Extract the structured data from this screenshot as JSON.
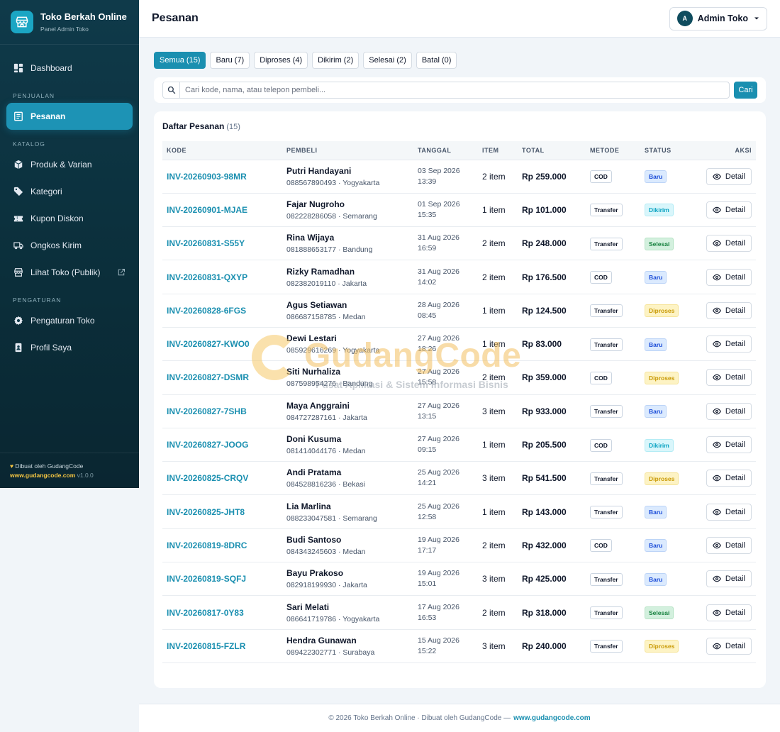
{
  "brand": {
    "name": "Toko Berkah Online",
    "subtitle": "Panel Admin Toko"
  },
  "sidebar": {
    "dashboard": "Dashboard",
    "section_penjualan": "PENJUALAN",
    "pesanan": "Pesanan",
    "section_katalog": "KATALOG",
    "produk": "Produk & Varian",
    "kategori": "Kategori",
    "kupon": "Kupon Diskon",
    "ongkos": "Ongkos Kirim",
    "lihat_toko": "Lihat Toko (Publik)",
    "section_pengaturan": "PENGATURAN",
    "pengaturan_toko": "Pengaturan Toko",
    "profil": "Profil Saya",
    "footer_credit": "Dibuat oleh GudangCode",
    "footer_url": "www.gudangcode.com",
    "footer_version": "v1.0.0"
  },
  "header": {
    "title": "Pesanan",
    "user_initial": "A",
    "user_name": "Admin Toko"
  },
  "tabs": [
    "Semua (15)",
    "Baru (7)",
    "Diproses (4)",
    "Dikirim (2)",
    "Selesai (2)",
    "Batal (0)"
  ],
  "search": {
    "placeholder": "Cari kode, nama, atau telepon pembeli...",
    "button": "Cari"
  },
  "orders_card": {
    "title": "Daftar Pesanan",
    "count": "(15)"
  },
  "columns": {
    "kode": "KODE",
    "pembeli": "PEMBELI",
    "tanggal": "TANGGAL",
    "item": "ITEM",
    "total": "TOTAL",
    "metode": "METODE",
    "status": "STATUS",
    "aksi": "AKSI"
  },
  "detail_label": "Detail",
  "orders": [
    {
      "code": "INV-20260903-98MR",
      "name": "Putri Handayani",
      "phone_city": "088567890493 · Yogyakarta",
      "date": "03 Sep 2026",
      "time": "13:39",
      "items": "2 item",
      "total": "Rp 259.000",
      "method": "COD",
      "status": "Baru",
      "status_class": "s-baru"
    },
    {
      "code": "INV-20260901-MJAE",
      "name": "Fajar Nugroho",
      "phone_city": "082228286058 · Semarang",
      "date": "01 Sep 2026",
      "time": "15:35",
      "items": "1 item",
      "total": "Rp 101.000",
      "method": "Transfer",
      "status": "Dikirim",
      "status_class": "s-dikirim"
    },
    {
      "code": "INV-20260831-S55Y",
      "name": "Rina Wijaya",
      "phone_city": "081888653177 · Bandung",
      "date": "31 Aug 2026",
      "time": "16:59",
      "items": "2 item",
      "total": "Rp 248.000",
      "method": "Transfer",
      "status": "Selesai",
      "status_class": "s-selesai"
    },
    {
      "code": "INV-20260831-QXYP",
      "name": "Rizky Ramadhan",
      "phone_city": "082382019110 · Jakarta",
      "date": "31 Aug 2026",
      "time": "14:02",
      "items": "2 item",
      "total": "Rp 176.500",
      "method": "COD",
      "status": "Baru",
      "status_class": "s-baru"
    },
    {
      "code": "INV-20260828-6FGS",
      "name": "Agus Setiawan",
      "phone_city": "086687158785 · Medan",
      "date": "28 Aug 2026",
      "time": "08:45",
      "items": "1 item",
      "total": "Rp 124.500",
      "method": "Transfer",
      "status": "Diproses",
      "status_class": "s-diproses"
    },
    {
      "code": "INV-20260827-KWO0",
      "name": "Dewi Lestari",
      "phone_city": "085929616269 · Yogyakarta",
      "date": "27 Aug 2026",
      "time": "18:26",
      "items": "1 item",
      "total": "Rp 83.000",
      "method": "Transfer",
      "status": "Baru",
      "status_class": "s-baru"
    },
    {
      "code": "INV-20260827-DSMR",
      "name": "Siti Nurhaliza",
      "phone_city": "087598954276 · Bandung",
      "date": "27 Aug 2026",
      "time": "15:58",
      "items": "2 item",
      "total": "Rp 359.000",
      "method": "COD",
      "status": "Diproses",
      "status_class": "s-diproses"
    },
    {
      "code": "INV-20260827-7SHB",
      "name": "Maya Anggraini",
      "phone_city": "084727287161 · Jakarta",
      "date": "27 Aug 2026",
      "time": "13:15",
      "items": "3 item",
      "total": "Rp 933.000",
      "method": "Transfer",
      "status": "Baru",
      "status_class": "s-baru"
    },
    {
      "code": "INV-20260827-JOOG",
      "name": "Doni Kusuma",
      "phone_city": "081414044176 · Medan",
      "date": "27 Aug 2026",
      "time": "09:15",
      "items": "1 item",
      "total": "Rp 205.500",
      "method": "COD",
      "status": "Dikirim",
      "status_class": "s-dikirim"
    },
    {
      "code": "INV-20260825-CRQV",
      "name": "Andi Pratama",
      "phone_city": "084528816236 · Bekasi",
      "date": "25 Aug 2026",
      "time": "14:21",
      "items": "3 item",
      "total": "Rp 541.500",
      "method": "Transfer",
      "status": "Diproses",
      "status_class": "s-diproses"
    },
    {
      "code": "INV-20260825-JHT8",
      "name": "Lia Marlina",
      "phone_city": "088233047581 · Semarang",
      "date": "25 Aug 2026",
      "time": "12:58",
      "items": "1 item",
      "total": "Rp 143.000",
      "method": "Transfer",
      "status": "Baru",
      "status_class": "s-baru"
    },
    {
      "code": "INV-20260819-8DRC",
      "name": "Budi Santoso",
      "phone_city": "084343245603 · Medan",
      "date": "19 Aug 2026",
      "time": "17:17",
      "items": "2 item",
      "total": "Rp 432.000",
      "method": "COD",
      "status": "Baru",
      "status_class": "s-baru"
    },
    {
      "code": "INV-20260819-SQFJ",
      "name": "Bayu Prakoso",
      "phone_city": "082918199930 · Jakarta",
      "date": "19 Aug 2026",
      "time": "15:01",
      "items": "3 item",
      "total": "Rp 425.000",
      "method": "Transfer",
      "status": "Baru",
      "status_class": "s-baru"
    },
    {
      "code": "INV-20260817-0Y83",
      "name": "Sari Melati",
      "phone_city": "086641719786 · Yogyakarta",
      "date": "17 Aug 2026",
      "time": "16:53",
      "items": "2 item",
      "total": "Rp 318.000",
      "method": "Transfer",
      "status": "Selesai",
      "status_class": "s-selesai"
    },
    {
      "code": "INV-20260815-FZLR",
      "name": "Hendra Gunawan",
      "phone_city": "089422302771 · Surabaya",
      "date": "15 Aug 2026",
      "time": "15:22",
      "items": "3 item",
      "total": "Rp 240.000",
      "method": "Transfer",
      "status": "Diproses",
      "status_class": "s-diproses"
    }
  ],
  "footer": {
    "text": "© 2026 Toko Berkah Online · Dibuat oleh GudangCode —",
    "link": "www.gudangcode.com"
  },
  "watermark": {
    "title": "GudangCode",
    "subtitle": "Pusat Aplikasi & Sistem Informasi Bisnis"
  },
  "colors": {
    "accent": "#1a8fb0",
    "sidebar_bg": "#0f3a4a",
    "brand_gold": "#f5c542"
  }
}
